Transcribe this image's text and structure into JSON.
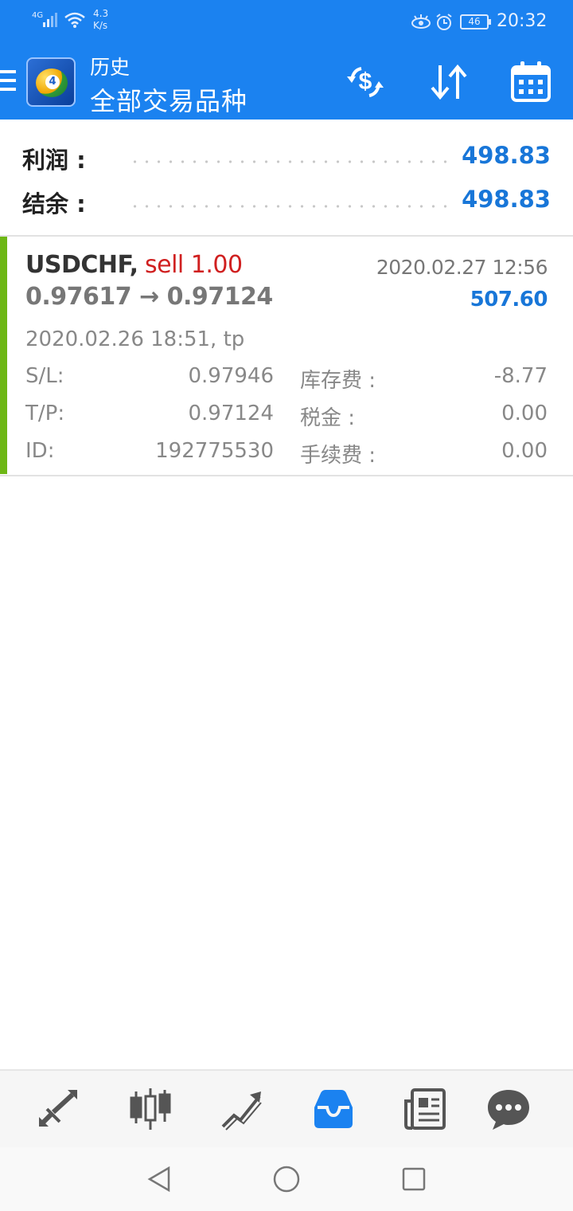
{
  "status_bar": {
    "network_type": "4G",
    "net_speed_value": "4.3",
    "net_speed_unit": "K/s",
    "battery": "46",
    "time": "20:32"
  },
  "header": {
    "title": "历史",
    "subtitle": "全部交易品种",
    "icons": [
      "menu-icon",
      "app-logo",
      "deposit-withdraw-icon",
      "sort-icon",
      "calendar-icon"
    ]
  },
  "summary": {
    "profit_label": "利润 :",
    "profit_value": "498.83",
    "balance_label": "结余 :",
    "balance_value": "498.83"
  },
  "deal": {
    "symbol": "USDCHF,",
    "type": "sell 1.00",
    "prices": "0.97617 → 0.97124",
    "close_time": "2020.02.27 12:56",
    "profit": "507.60",
    "open_time": "2020.02.26 18:51, tp",
    "sl_label": "S/L:",
    "sl_value": "0.97946",
    "tp_label": "T/P:",
    "tp_value": "0.97124",
    "id_label": "ID:",
    "id_value": "192775530",
    "swap_label": "库存费 :",
    "swap_value": "-8.77",
    "tax_label": "税金 :",
    "tax_value": "0.00",
    "commission_label": "手续费 :",
    "commission_value": "0.00",
    "accent_color": "#6db715"
  },
  "bottom_nav": {
    "items": [
      "quotes-icon",
      "chart-icon",
      "trade-icon",
      "history-icon",
      "news-icon",
      "chat-icon"
    ],
    "active": "history-icon",
    "active_color": "#1b82f0"
  },
  "system_nav": [
    "back-icon",
    "home-icon",
    "recents-icon"
  ],
  "colors": {
    "header_bg": "#1b82f0",
    "value_blue": "#1876d8",
    "sell_red": "#d02020"
  }
}
